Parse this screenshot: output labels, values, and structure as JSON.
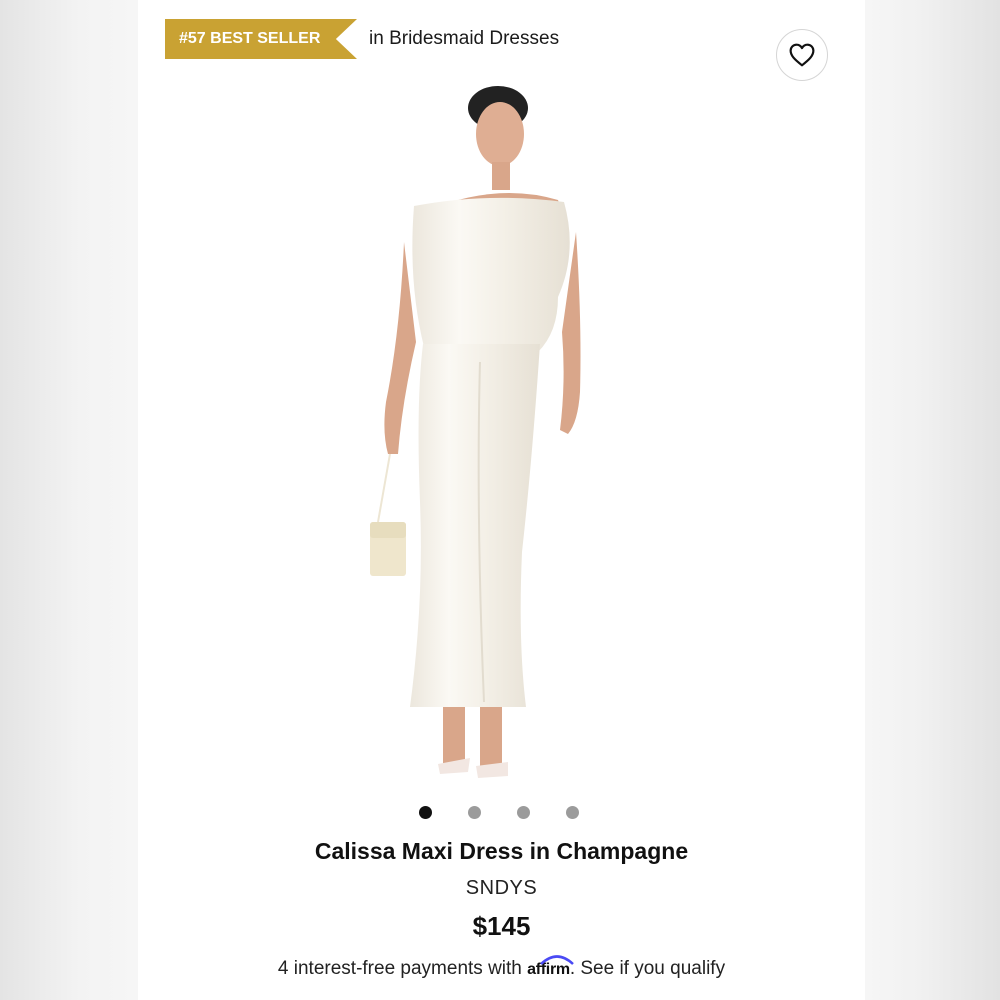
{
  "badge": {
    "rank_label": "#57 BEST SELLER",
    "category": "in Bridesmaid Dresses",
    "color": "#c9a233"
  },
  "favorite": {
    "icon": "heart-icon"
  },
  "carousel": {
    "total": 4,
    "active": 1
  },
  "product": {
    "name": "Calissa Maxi Dress in Champagne",
    "brand": "SNDYS",
    "price": "$145"
  },
  "financing": {
    "text_before": "4 interest-free payments with",
    "provider": "affirm",
    "text_after": ". See if you qualify"
  }
}
